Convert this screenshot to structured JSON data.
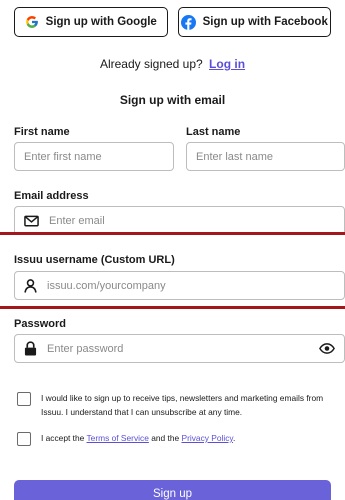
{
  "oauth": {
    "google_label": "Sign up with Google",
    "facebook_label": "Sign up with Facebook"
  },
  "already": {
    "text": "Already signed up?",
    "login_link": "Log in"
  },
  "email_heading": "Sign up with email",
  "form": {
    "first_name": {
      "label": "First name",
      "placeholder": "Enter first name"
    },
    "last_name": {
      "label": "Last name",
      "placeholder": "Enter last name"
    },
    "email": {
      "label": "Email address",
      "placeholder": "Enter email"
    },
    "username": {
      "label": "Issuu username (Custom URL)",
      "placeholder": "issuu.com/yourcompany"
    },
    "password": {
      "label": "Password",
      "placeholder": "Enter password"
    }
  },
  "consents": {
    "marketing": "I would like to sign up to receive tips, newsletters and marketing emails from Issuu. I understand that I can unsubscribe at any time.",
    "terms_prefix": "I accept the",
    "terms_link": "Terms of Service",
    "terms_and": "and the",
    "privacy_link": "Privacy Policy",
    "terms_suffix": "."
  },
  "submit_label": "Sign up",
  "colors": {
    "accent": "#5b4fd6",
    "button": "#6a62d9",
    "red_rule": "#a3161b",
    "facebook": "#1877f2"
  },
  "icons": [
    "google-icon",
    "facebook-icon",
    "mail-icon",
    "user-icon",
    "lock-icon",
    "eye-icon"
  ]
}
